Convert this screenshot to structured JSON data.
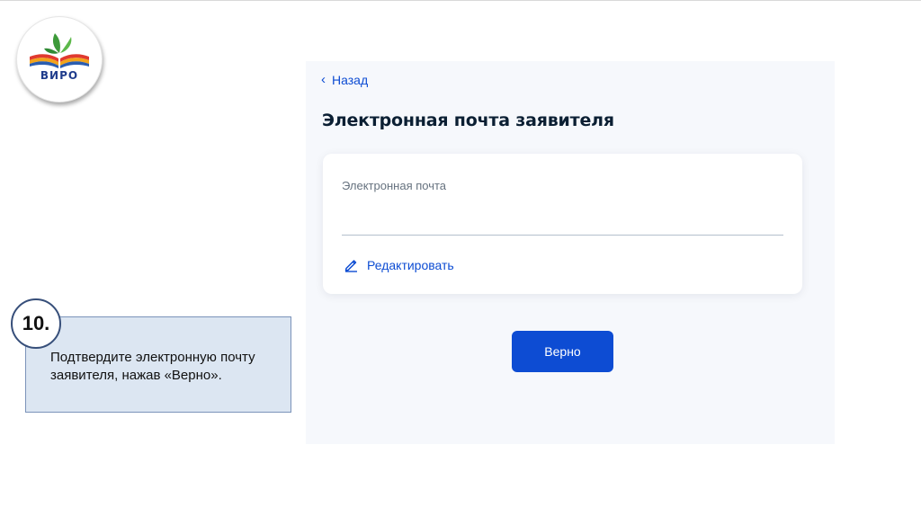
{
  "logo": {
    "text": "ВИРО"
  },
  "step": {
    "number": "10.",
    "instruction": "Подтвердите электронную почту заявителя, нажав «Верно»."
  },
  "form": {
    "back_label": "Назад",
    "title": "Электронная почта заявителя",
    "email_label": "Электронная почта",
    "email_value": "",
    "edit_label": "Редактировать",
    "confirm_label": "Верно"
  },
  "icons": {
    "back": "chevron-left-icon",
    "edit": "pencil-icon",
    "logo": "open-book-with-leaves"
  },
  "colors": {
    "accent": "#0d4cd3",
    "title": "#0b1f33",
    "step_panel": "#dce6f2",
    "screen_bg": "#f6f8fc"
  }
}
